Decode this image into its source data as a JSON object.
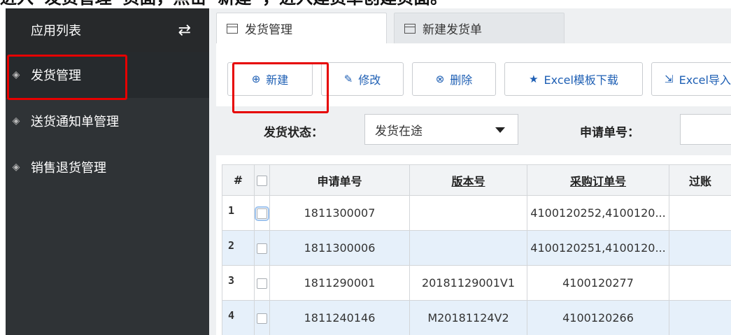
{
  "instruction_text": "进入“发货管理”页面，点击“新建”，进入建货单创建页面。",
  "sidebar": {
    "title": "应用列表",
    "switch_icon": "swap-arrows-icon",
    "items": [
      {
        "label": "发货管理",
        "icon": "layers-icon"
      },
      {
        "label": "送货通知单管理",
        "icon": "layers-icon"
      },
      {
        "label": "销售退货管理",
        "icon": "layers-icon"
      }
    ]
  },
  "tabs": [
    {
      "label": "发货管理",
      "icon": "window-icon"
    },
    {
      "label": "新建发货单",
      "icon": "window-icon"
    }
  ],
  "toolbar": {
    "new_label": "新建",
    "edit_label": "修改",
    "delete_label": "删除",
    "template_label": "Excel模板下载",
    "import_label": "Excel导入"
  },
  "filter": {
    "status_label": "发货状态：",
    "status_value": "发货在途",
    "apply_no_label": "申请单号："
  },
  "table": {
    "headers": [
      "#",
      "",
      "申请单号",
      "版本号",
      "采购订单号",
      "过账"
    ],
    "rows": [
      {
        "index": "1",
        "apply_no": "1811300007",
        "version": "",
        "po": "4100120252,4100120..."
      },
      {
        "index": "2",
        "apply_no": "1811300006",
        "version": "",
        "po": "4100120251,4100120..."
      },
      {
        "index": "3",
        "apply_no": "1811290001",
        "version": "20181129001V1",
        "po": "4100120277"
      },
      {
        "index": "4",
        "apply_no": "1811240146",
        "version": "M20181124V2",
        "po": "4100120266"
      }
    ]
  },
  "colors": {
    "sidebar_bg": "#2f3336",
    "highlight": "#e60000",
    "accent": "#1e5fb4",
    "row_alt": "#e6f0fa"
  }
}
